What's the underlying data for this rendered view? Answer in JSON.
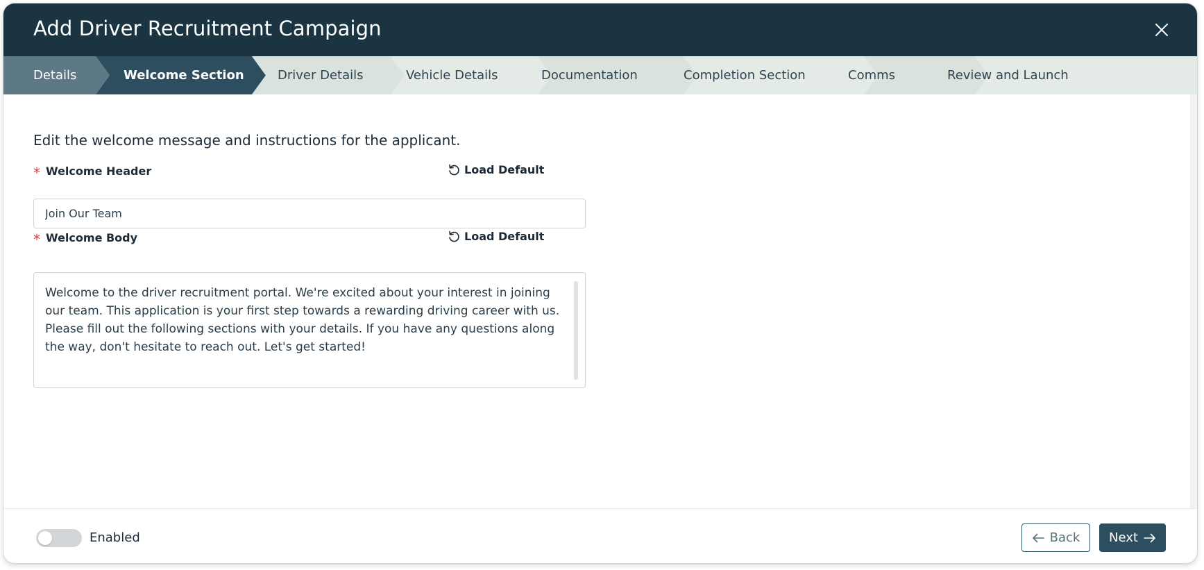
{
  "modal": {
    "title": "Add Driver Recruitment Campaign",
    "close_icon": "close-icon"
  },
  "steps": [
    {
      "label": "Details",
      "state": "completed"
    },
    {
      "label": "Welcome Section",
      "state": "active"
    },
    {
      "label": "Driver Details",
      "state": "upcoming"
    },
    {
      "label": "Vehicle Details",
      "state": "upcoming"
    },
    {
      "label": "Documentation",
      "state": "upcoming"
    },
    {
      "label": "Completion Section",
      "state": "upcoming"
    },
    {
      "label": "Comms",
      "state": "upcoming"
    },
    {
      "label": "Review and Launch",
      "state": "upcoming"
    }
  ],
  "content": {
    "intro": "Edit the welcome message and instructions for the applicant.",
    "welcome_header": {
      "label": "Welcome Header",
      "required": true,
      "load_default": "Load Default",
      "value": "Join Our Team"
    },
    "welcome_body": {
      "label": "Welcome Body",
      "required": true,
      "load_default": "Load Default",
      "value": "Welcome to the driver recruitment portal. We're excited about your interest in joining our team. This application is your first step towards a rewarding driving career with us. Please fill out the following sections with your details. If you have any questions along the way, don't hesitate to reach out. Let's get started!"
    }
  },
  "footer": {
    "toggle_label": "Enabled",
    "enabled": false,
    "back_label": "Back",
    "next_label": "Next"
  },
  "colors": {
    "header_bg": "#1a3442",
    "step_completed": "#5d7985",
    "step_active": "#2c4e5e",
    "step_upcoming_a": "#d9e2dd",
    "step_upcoming_b": "#e4eae6",
    "required": "#e23b3b",
    "primary_button": "#2c4e5e"
  }
}
